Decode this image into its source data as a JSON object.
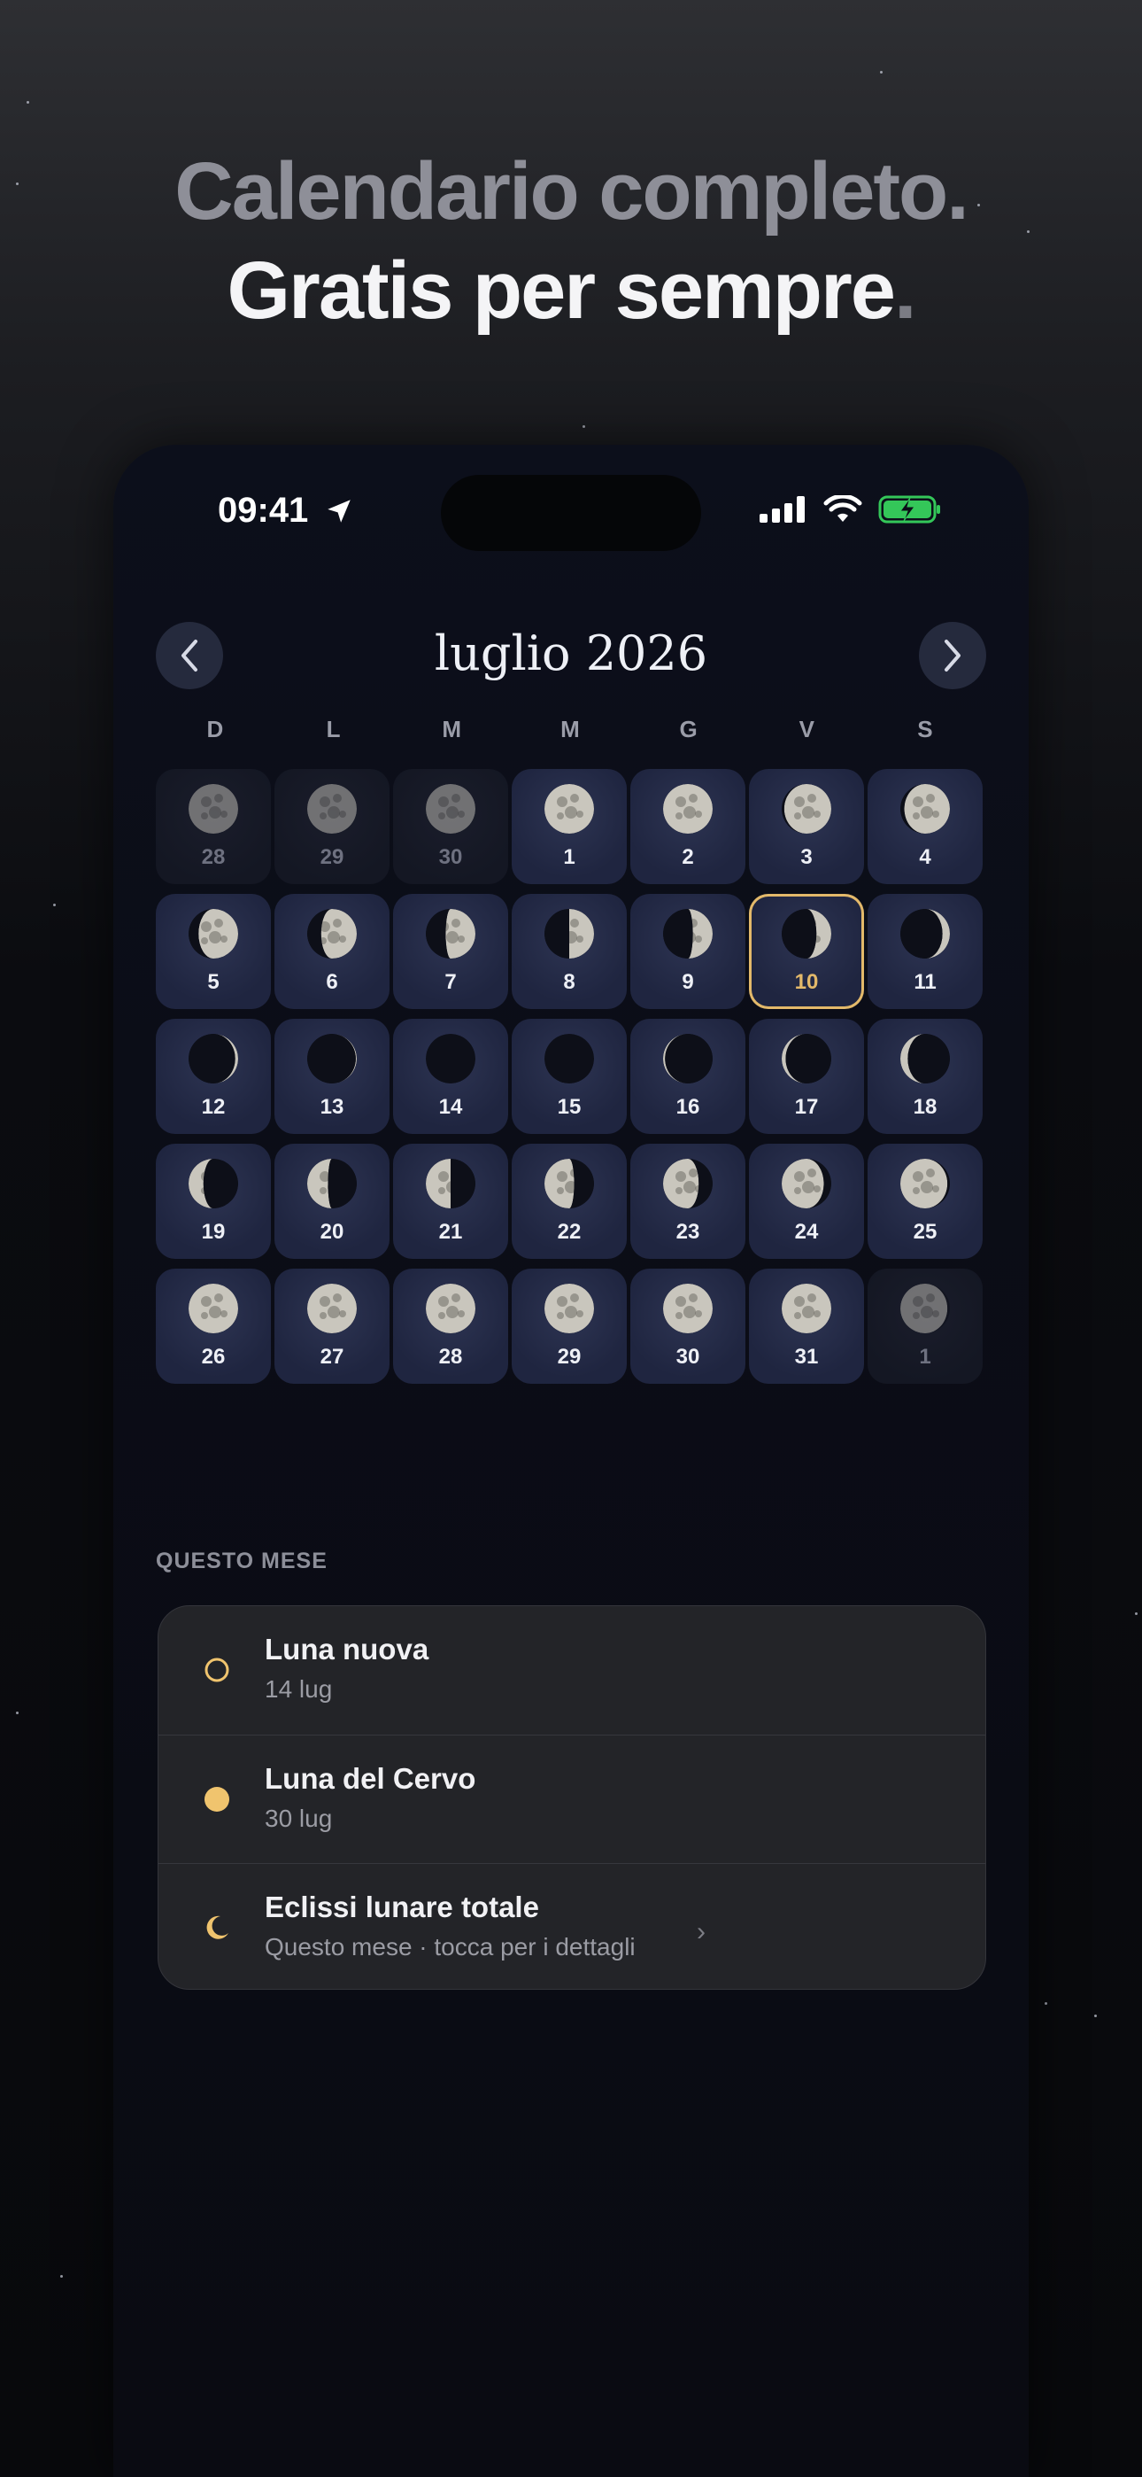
{
  "headline": {
    "line1": "Calendario completo",
    "line2": "Gratis per sempre",
    "dot": "."
  },
  "status_bar": {
    "time": "09:41",
    "icons": [
      "location-arrow-icon",
      "signal-icon",
      "wifi-icon",
      "battery-charging-icon"
    ],
    "battery_color": "#34c759"
  },
  "calendar": {
    "month_title": "luglio 2026",
    "prev_icon": "chevron-left-icon",
    "next_icon": "chevron-right-icon",
    "weekdays": [
      "D",
      "L",
      "M",
      "M",
      "G",
      "V",
      "S"
    ],
    "today": "10",
    "accent": "#e3b96a",
    "days": [
      {
        "n": "28",
        "dim": true,
        "lit": 1.0,
        "side": "r"
      },
      {
        "n": "29",
        "dim": true,
        "lit": 1.0,
        "side": "r"
      },
      {
        "n": "30",
        "dim": true,
        "lit": 1.0,
        "side": "r"
      },
      {
        "n": "1",
        "lit": 1.0,
        "side": "r"
      },
      {
        "n": "2",
        "lit": 1.0,
        "side": "r"
      },
      {
        "n": "3",
        "lit": 0.95,
        "side": "r"
      },
      {
        "n": "4",
        "lit": 0.92,
        "side": "r"
      },
      {
        "n": "5",
        "lit": 0.8,
        "side": "r"
      },
      {
        "n": "6",
        "lit": 0.72,
        "side": "r"
      },
      {
        "n": "7",
        "lit": 0.6,
        "side": "r"
      },
      {
        "n": "8",
        "lit": 0.5,
        "side": "r"
      },
      {
        "n": "9",
        "lit": 0.4,
        "side": "r"
      },
      {
        "n": "10",
        "lit": 0.3,
        "side": "r"
      },
      {
        "n": "11",
        "lit": 0.15,
        "side": "r"
      },
      {
        "n": "12",
        "lit": 0.06,
        "side": "r"
      },
      {
        "n": "13",
        "lit": 0.02,
        "side": "r"
      },
      {
        "n": "14",
        "lit": 0.0,
        "side": "r"
      },
      {
        "n": "15",
        "lit": 0.0,
        "side": "r"
      },
      {
        "n": "16",
        "lit": 0.04,
        "side": "l"
      },
      {
        "n": "17",
        "lit": 0.08,
        "side": "l"
      },
      {
        "n": "18",
        "lit": 0.15,
        "side": "l"
      },
      {
        "n": "19",
        "lit": 0.3,
        "side": "l"
      },
      {
        "n": "20",
        "lit": 0.42,
        "side": "l"
      },
      {
        "n": "21",
        "lit": 0.5,
        "side": "l"
      },
      {
        "n": "22",
        "lit": 0.6,
        "side": "l"
      },
      {
        "n": "23",
        "lit": 0.72,
        "side": "l"
      },
      {
        "n": "24",
        "lit": 0.85,
        "side": "l"
      },
      {
        "n": "25",
        "lit": 0.95,
        "side": "l"
      },
      {
        "n": "26",
        "lit": 1.0,
        "side": "l"
      },
      {
        "n": "27",
        "lit": 1.0,
        "side": "l"
      },
      {
        "n": "28",
        "lit": 1.0,
        "side": "l"
      },
      {
        "n": "29",
        "lit": 1.0,
        "side": "l"
      },
      {
        "n": "30",
        "lit": 1.0,
        "side": "l"
      },
      {
        "n": "31",
        "lit": 1.0,
        "side": "l"
      },
      {
        "n": "1",
        "dim": true,
        "lit": 0.95,
        "side": "l"
      }
    ]
  },
  "this_month": {
    "label": "QUESTO MESE",
    "items": [
      {
        "title": "Luna nuova",
        "subtitle": "14 lug",
        "icon": "new-moon-ring-icon"
      },
      {
        "title": "Luna del Cervo",
        "subtitle": "30 lug",
        "icon": "full-moon-dot-icon"
      },
      {
        "title": "Eclissi lunare totale",
        "subtitle": "Questo mese · tocca per i dettagli",
        "icon": "crescent-moon-icon",
        "chevron": "›"
      }
    ]
  }
}
